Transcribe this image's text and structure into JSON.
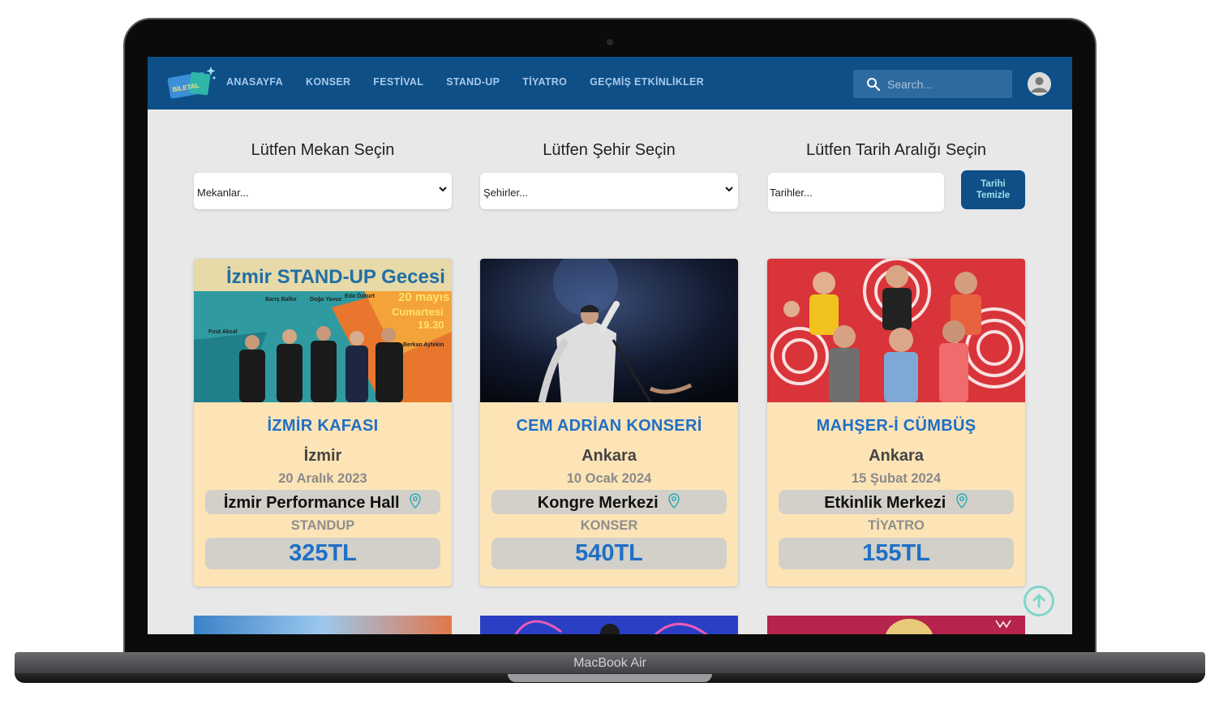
{
  "device": {
    "label": "MacBook Air"
  },
  "nav": {
    "logo_text": "BİLETAL",
    "links": [
      "ANASAYFA",
      "KONSER",
      "FESTİVAL",
      "STAND-UP",
      "TİYATRO",
      "GEÇMİŞ ETKİNLİKLER"
    ],
    "search_placeholder": "Search..."
  },
  "filters": {
    "venue_title": "Lütfen Mekan Seçin",
    "venue_value": "Mekanlar...",
    "city_title": "Lütfen Şehir Seçin",
    "city_value": "Şehirler...",
    "date_title": "Lütfen Tarih Aralığı Seçin",
    "date_placeholder": "Tarihler...",
    "clear_label_1": "Tarihi",
    "clear_label_2": "Temizle"
  },
  "events": [
    {
      "title": "İZMİR KAFASI",
      "city": "İzmir",
      "date": "20 Aralık 2023",
      "venue": "İzmir Performance Hall",
      "category": "STANDUP",
      "price": "325TL",
      "poster": {
        "headline": "İzmir STAND-UP Gecesi",
        "date_line_1": "20 mayıs",
        "date_line_2": "Cumartesi",
        "time": "19.30",
        "names": [
          "Barış Balkır",
          "Doğa Yavuz",
          "Eda Özkurt",
          "Fırat Aksal",
          "Berkan Aytekin"
        ]
      }
    },
    {
      "title": "CEM ADRİAN KONSERİ",
      "city": "Ankara",
      "date": "10 Ocak 2024",
      "venue": "Kongre Merkezi",
      "category": "KONSER",
      "price": "540TL"
    },
    {
      "title": "MAHŞER-İ CÜMBÜŞ",
      "city": "Ankara",
      "date": "15 Şubat 2024",
      "venue": "Etkinlik Merkezi",
      "category": "TİYATRO",
      "price": "155TL"
    }
  ],
  "colors": {
    "navbar": "#0d4f86",
    "card": "#fde4b6",
    "title": "#1f6fc6",
    "accent": "#7fd6c9"
  }
}
